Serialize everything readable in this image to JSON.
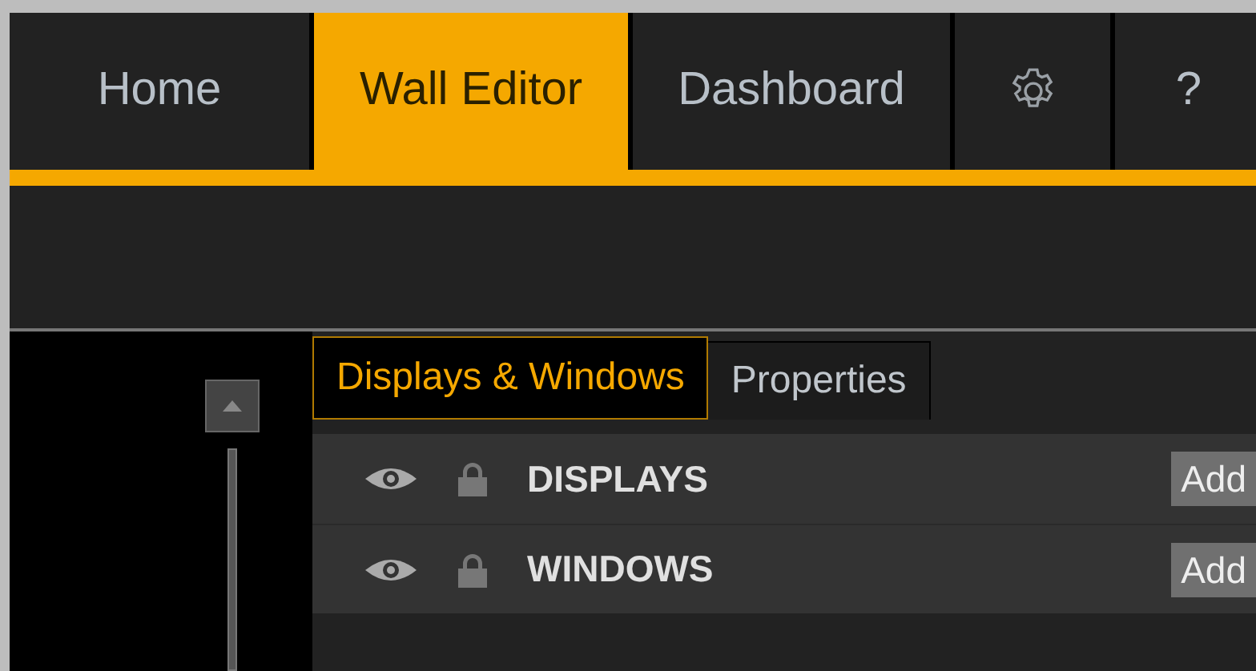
{
  "nav_tabs": [
    {
      "kind": "text",
      "label": "Home",
      "selected": false
    },
    {
      "kind": "text",
      "label": "Wall Editor",
      "selected": true
    },
    {
      "kind": "text",
      "label": "Dashboard",
      "selected": false
    },
    {
      "kind": "settings",
      "selected": false
    },
    {
      "kind": "text",
      "label": "?",
      "selected": false
    }
  ],
  "panel_tabs": [
    {
      "label": "Displays & Windows",
      "selected": true
    },
    {
      "label": "Properties",
      "selected": false
    }
  ],
  "groups": [
    {
      "name": "DISPLAYS",
      "action": "Add"
    },
    {
      "name": "WINDOWS",
      "action": "Add"
    }
  ]
}
